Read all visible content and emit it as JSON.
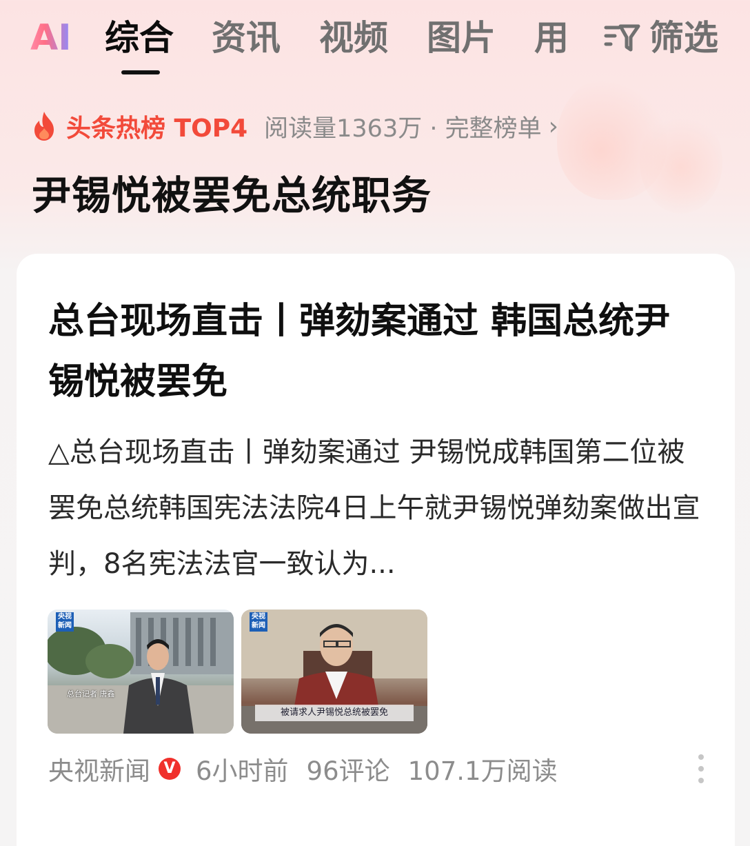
{
  "tabs": {
    "ai": "AI",
    "items": [
      "综合",
      "资讯",
      "视频",
      "图片",
      "用"
    ],
    "filter_label": "筛选"
  },
  "hot": {
    "title": "头条热榜 TOP4",
    "meta": "阅读量1363万 · 完整榜单",
    "arrow": "›"
  },
  "topic": "尹锡悦被罢免总统职务",
  "card": {
    "title": "总台现场直击丨弹劾案通过 韩国总统尹锡悦被罢免",
    "summary": "△总台现场直击丨弹劾案通过 尹锡悦成韩国第二位被罢免总统韩国宪法法院4日上午就尹锡悦弹劾案做出宣判，8名宪法法官一致认为...",
    "thumb1": {
      "logo": "央视新闻",
      "overlay": "总台记者 唐鑫"
    },
    "thumb2": {
      "logo": "央视新闻",
      "caption": "被请求人尹锡悦总统被罢免"
    }
  },
  "meta": {
    "source": "央视新闻",
    "verified": "V",
    "time": "6小时前",
    "comments": "96评论",
    "reads": "107.1万阅读"
  },
  "colors": {
    "accent": "#f24a3a",
    "verified": "#f0302b",
    "muted": "#8c8c8c"
  }
}
